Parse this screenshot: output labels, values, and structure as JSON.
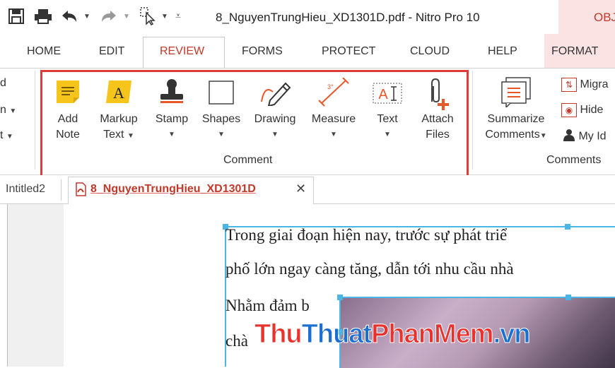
{
  "title_bar": {
    "document_title": "8_NguyenTrungHieu_XD1301D.pdf - Nitro Pro 10",
    "context_tab": "OBJ"
  },
  "tabs": [
    {
      "label": "HOME"
    },
    {
      "label": "EDIT"
    },
    {
      "label": "REVIEW"
    },
    {
      "label": "FORMS"
    },
    {
      "label": "PROTECT"
    },
    {
      "label": "CLOUD"
    },
    {
      "label": "HELP"
    },
    {
      "label": "FORMAT"
    }
  ],
  "ribbon": {
    "left_partial": [
      "d",
      "n",
      "t"
    ],
    "comment_group": {
      "label": "Comment",
      "buttons": [
        {
          "line1": "Add",
          "line2": "Note",
          "icon": "note-icon"
        },
        {
          "line1": "Markup",
          "line2": "Text",
          "icon": "markup-text-icon"
        },
        {
          "line1": "Stamp",
          "line2": "",
          "icon": "stamp-icon"
        },
        {
          "line1": "Shapes",
          "line2": "",
          "icon": "shapes-icon"
        },
        {
          "line1": "Drawing",
          "line2": "",
          "icon": "pencil-icon"
        },
        {
          "line1": "Measure",
          "line2": "",
          "icon": "ruler-icon"
        },
        {
          "line1": "Text",
          "line2": "",
          "icon": "text-box-icon"
        },
        {
          "line1": "Attach",
          "line2": "Files",
          "icon": "paperclip-icon"
        }
      ]
    },
    "comments_group": {
      "label": "Comments",
      "summarize": {
        "line1": "Summarize",
        "line2": "Comments"
      },
      "side_items": [
        {
          "label": "Migra",
          "icon": "migrate-icon"
        },
        {
          "label": "Hide",
          "icon": "hide-icon"
        },
        {
          "label": "My Id",
          "icon": "person-icon"
        }
      ]
    }
  },
  "document_tabs": {
    "inactive": "Intitled2",
    "active": "8_NguyenTrungHieu_XD1301D"
  },
  "document": {
    "lines": [
      "Trong giai đoạn hiện nay,  trước sự phát triể",
      "phố lớn ngay càng tăng, dẫn tới nhu cầu nhà",
      "Nhằm đảm b",
      "chà"
    ],
    "watermark": {
      "part1": "Thu",
      "part2": "Thuat",
      "part3": "PhanMem",
      "part4": ".vn"
    }
  }
}
